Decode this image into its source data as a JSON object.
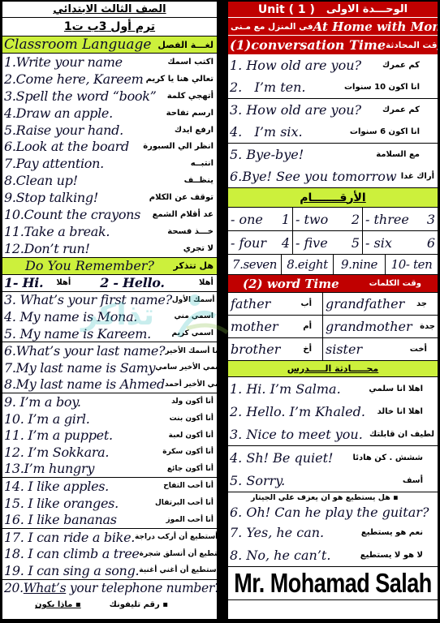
{
  "left": {
    "grade": "الصف الثالث الابتدائي",
    "term": "ترم أول  3ب ت1",
    "classroom": {
      "title_en": "Classroom Language",
      "title_ar": "لغـــة الفصل",
      "items": [
        {
          "en": "1.Write your name",
          "ar": "اكتب اسمك"
        },
        {
          "en": "2.Come here, Kareem",
          "ar": "تعالي هنا يا كريم"
        },
        {
          "en": "3.Spell the word “book”",
          "ar": "أتهجي كلمة"
        },
        {
          "en": "4.Draw an apple.",
          "ar": "ارسم تفاحة"
        },
        {
          "en": "5.Raise your hand.",
          "ar": "ارفع ايدك"
        },
        {
          "en": "6.Look at the board",
          "ar": "انظر الي السبورة"
        },
        {
          "en": "7.Pay attention.",
          "ar": "انتبــه"
        },
        {
          "en": "8.Clean up!",
          "ar": "ينظــف"
        },
        {
          "en": "9.Stop talking!",
          "ar": "توقف عن الكلام"
        },
        {
          "en": "10.Count the crayons",
          "ar": "عد أقلام الشمع"
        },
        {
          "en": "11.Take a break.",
          "ar": "خـــذ فسحة"
        },
        {
          "en": "12.Don’t run!",
          "ar": "لا تجري"
        }
      ]
    },
    "remember": {
      "title_en": "Do You Remember?",
      "title_ar": "هل تتذكر",
      "first_row": [
        {
          "en": "1- Hi.",
          "ar": "أهلا"
        },
        {
          "en": "2 - Hello.",
          "ar": "أهلا"
        }
      ],
      "groups": [
        [
          {
            "en": "3. What’s your first name?",
            "ar": "ما أسمك الأول"
          },
          {
            "en": "4. My name is Mona.",
            "ar": "اسمي مني"
          },
          {
            "en": "5. My name is Kareem.",
            "ar": "اسمي كريم"
          }
        ],
        [
          {
            "en": "6.What’s your last name?",
            "ar": "ما أسمك الأخير"
          },
          {
            "en": "7.My last name is Samy",
            "ar": "اسمي الأخير سامي"
          },
          {
            "en": "8.My last name is Ahmed",
            "ar": "اسمي الأخير أحمد"
          }
        ],
        [
          {
            "en": "9. I’m a boy.",
            "ar": "أنا أكون ولد"
          },
          {
            "en": "10. I’m a girl.",
            "ar": "أنا أكون بنت"
          },
          {
            "en": "11. I’m a puppet.",
            "ar": "أنا أكون لعبة"
          },
          {
            "en": "12. I’m Sokkara.",
            "ar": "أنا أكون سكرة"
          },
          {
            "en": "13.I’m hungry",
            "ar": "أنا أكون جائع"
          }
        ],
        [
          {
            "en": "14. I like apples.",
            "ar": "أنا أحب التفاح"
          },
          {
            "en": "15. I like oranges.",
            "ar": "أنا أحب البرتقال"
          },
          {
            "en": "16. I like bananas",
            "ar": "أنا أحب الموز"
          }
        ],
        [
          {
            "en": "17. I can ride a bike.",
            "ar": "أنا أستطيع أن أركب دراجة"
          },
          {
            "en": "18. I can climb a tree",
            "ar": "أنا أستطيع أن أتسلق شجرة"
          },
          {
            "en": "19. I can sing a song.",
            "ar": "أنا أستطيع أن أغني أغنية"
          }
        ]
      ],
      "last": {
        "num": "20.",
        "what": "What’s",
        "rest": " your telephone number?",
        "ar_right": "▪ رقم تليفونك",
        "ar_left": "▪ ماذا يكون"
      }
    }
  },
  "right": {
    "unit_en": "Unit ( 1 )",
    "unit_ar": "الوحـــدة الاولى",
    "theme_en": "At Home with Mona",
    "theme_ar": "فى المنزل مع مـنى",
    "conversation": {
      "title_en": "(1)conversation Time",
      "title_ar": "وقت المحادثة",
      "groups": [
        [
          {
            "en": "1. How old are you?",
            "ar": "كم عمرك"
          },
          {
            "en": "2.   I’m ten.",
            "ar": "انا اكون 10 سنوات"
          }
        ],
        [
          {
            "en": "3. How old are you?",
            "ar": "كم عمرك"
          },
          {
            "en": "4.   I’m six.",
            "ar": "انا اكون 6 سنوات"
          }
        ],
        [
          {
            "en": "5. Bye-bye!",
            "ar": "مع السلامة"
          },
          {
            "en": "6.Bye! See you tomorrow",
            "ar": "أراك غدا"
          }
        ]
      ]
    },
    "numbers": {
      "title_ar": "الأرقـــــــام",
      "row1": [
        {
          "en": "- one",
          "num": "1"
        },
        {
          "en": "- two",
          "num": "2"
        },
        {
          "en": "- three",
          "num": "3"
        }
      ],
      "row2": [
        {
          "en": "- four",
          "num": "4"
        },
        {
          "en": "- five",
          "num": "5"
        },
        {
          "en": "- six",
          "num": "6"
        }
      ],
      "row3": [
        "7.seven",
        "8.eight",
        "9.nine",
        "10- ten"
      ]
    },
    "words": {
      "title_en": "(2) word Time",
      "title_ar": "وقت الكلمات",
      "rows": [
        [
          {
            "en": "father",
            "ar": "أب"
          },
          {
            "en": "grandfather",
            "ar": "جد"
          }
        ],
        [
          {
            "en": "mother",
            "ar": "أم"
          },
          {
            "en": "grandmother",
            "ar": "جدة"
          }
        ],
        [
          {
            "en": "brother",
            "ar": "أخ"
          },
          {
            "en": "sister",
            "ar": "أخت"
          }
        ]
      ]
    },
    "lesson": {
      "title_ar": "محـــــادثة الـــــدرس",
      "groups": [
        [
          {
            "en": "1. Hi. I’m Salma.",
            "ar": "اهلا انا سلمي"
          },
          {
            "en": "2. Hello. I’m Khaled.",
            "ar": "اهلا انا خالد"
          },
          {
            "en": "3. Nice to meet you.",
            "ar": "لطيف ان قابلتك"
          }
        ],
        [
          {
            "en": "4. Sh! Be quiet!",
            "ar": "ششش . كن هادئا"
          },
          {
            "en": "5. Sorry.",
            "ar": "أسف"
          }
        ]
      ],
      "guitar_ar": "▪ هل يستطيع هو ان يعزف علي الجيتار",
      "guitar_en": "6. Oh! Can he play the guitar?",
      "answers": [
        {
          "en": "7. Yes, he can.",
          "ar": "نعم هو يستطيع"
        },
        {
          "en": "8. No, he can’t.",
          "ar": "لا هو لا يستطيع"
        }
      ]
    },
    "signature": "Mr. Mohamad Salah"
  },
  "colors": {
    "header_red": "#c00000",
    "header_green": "#ccf03c",
    "text_navy": "#0b0b2a"
  }
}
